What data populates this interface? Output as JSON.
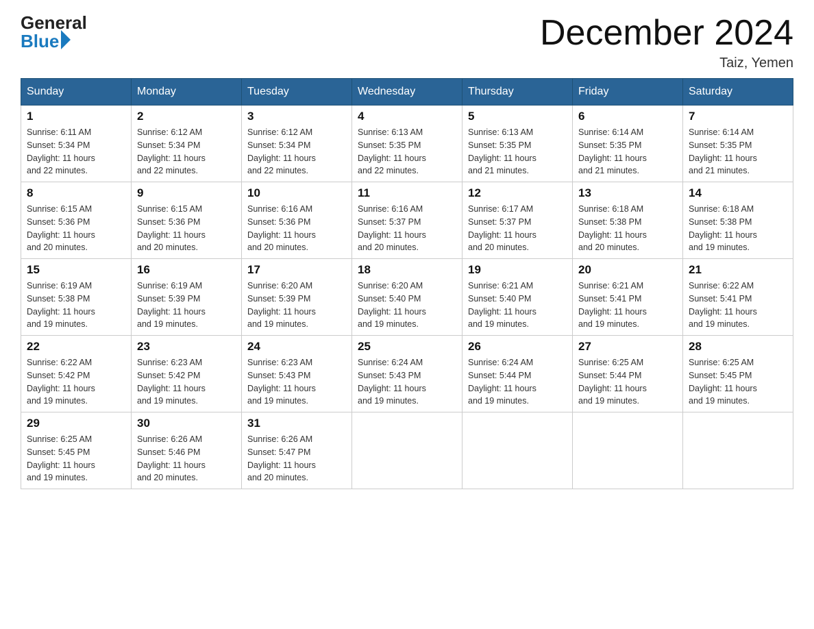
{
  "header": {
    "logo_general": "General",
    "logo_blue": "Blue",
    "month_title": "December 2024",
    "location": "Taiz, Yemen"
  },
  "weekdays": [
    "Sunday",
    "Monday",
    "Tuesday",
    "Wednesday",
    "Thursday",
    "Friday",
    "Saturday"
  ],
  "weeks": [
    [
      {
        "day": "1",
        "sunrise": "6:11 AM",
        "sunset": "5:34 PM",
        "daylight": "11 hours and 22 minutes."
      },
      {
        "day": "2",
        "sunrise": "6:12 AM",
        "sunset": "5:34 PM",
        "daylight": "11 hours and 22 minutes."
      },
      {
        "day": "3",
        "sunrise": "6:12 AM",
        "sunset": "5:34 PM",
        "daylight": "11 hours and 22 minutes."
      },
      {
        "day": "4",
        "sunrise": "6:13 AM",
        "sunset": "5:35 PM",
        "daylight": "11 hours and 22 minutes."
      },
      {
        "day": "5",
        "sunrise": "6:13 AM",
        "sunset": "5:35 PM",
        "daylight": "11 hours and 21 minutes."
      },
      {
        "day": "6",
        "sunrise": "6:14 AM",
        "sunset": "5:35 PM",
        "daylight": "11 hours and 21 minutes."
      },
      {
        "day": "7",
        "sunrise": "6:14 AM",
        "sunset": "5:35 PM",
        "daylight": "11 hours and 21 minutes."
      }
    ],
    [
      {
        "day": "8",
        "sunrise": "6:15 AM",
        "sunset": "5:36 PM",
        "daylight": "11 hours and 20 minutes."
      },
      {
        "day": "9",
        "sunrise": "6:15 AM",
        "sunset": "5:36 PM",
        "daylight": "11 hours and 20 minutes."
      },
      {
        "day": "10",
        "sunrise": "6:16 AM",
        "sunset": "5:36 PM",
        "daylight": "11 hours and 20 minutes."
      },
      {
        "day": "11",
        "sunrise": "6:16 AM",
        "sunset": "5:37 PM",
        "daylight": "11 hours and 20 minutes."
      },
      {
        "day": "12",
        "sunrise": "6:17 AM",
        "sunset": "5:37 PM",
        "daylight": "11 hours and 20 minutes."
      },
      {
        "day": "13",
        "sunrise": "6:18 AM",
        "sunset": "5:38 PM",
        "daylight": "11 hours and 20 minutes."
      },
      {
        "day": "14",
        "sunrise": "6:18 AM",
        "sunset": "5:38 PM",
        "daylight": "11 hours and 19 minutes."
      }
    ],
    [
      {
        "day": "15",
        "sunrise": "6:19 AM",
        "sunset": "5:38 PM",
        "daylight": "11 hours and 19 minutes."
      },
      {
        "day": "16",
        "sunrise": "6:19 AM",
        "sunset": "5:39 PM",
        "daylight": "11 hours and 19 minutes."
      },
      {
        "day": "17",
        "sunrise": "6:20 AM",
        "sunset": "5:39 PM",
        "daylight": "11 hours and 19 minutes."
      },
      {
        "day": "18",
        "sunrise": "6:20 AM",
        "sunset": "5:40 PM",
        "daylight": "11 hours and 19 minutes."
      },
      {
        "day": "19",
        "sunrise": "6:21 AM",
        "sunset": "5:40 PM",
        "daylight": "11 hours and 19 minutes."
      },
      {
        "day": "20",
        "sunrise": "6:21 AM",
        "sunset": "5:41 PM",
        "daylight": "11 hours and 19 minutes."
      },
      {
        "day": "21",
        "sunrise": "6:22 AM",
        "sunset": "5:41 PM",
        "daylight": "11 hours and 19 minutes."
      }
    ],
    [
      {
        "day": "22",
        "sunrise": "6:22 AM",
        "sunset": "5:42 PM",
        "daylight": "11 hours and 19 minutes."
      },
      {
        "day": "23",
        "sunrise": "6:23 AM",
        "sunset": "5:42 PM",
        "daylight": "11 hours and 19 minutes."
      },
      {
        "day": "24",
        "sunrise": "6:23 AM",
        "sunset": "5:43 PM",
        "daylight": "11 hours and 19 minutes."
      },
      {
        "day": "25",
        "sunrise": "6:24 AM",
        "sunset": "5:43 PM",
        "daylight": "11 hours and 19 minutes."
      },
      {
        "day": "26",
        "sunrise": "6:24 AM",
        "sunset": "5:44 PM",
        "daylight": "11 hours and 19 minutes."
      },
      {
        "day": "27",
        "sunrise": "6:25 AM",
        "sunset": "5:44 PM",
        "daylight": "11 hours and 19 minutes."
      },
      {
        "day": "28",
        "sunrise": "6:25 AM",
        "sunset": "5:45 PM",
        "daylight": "11 hours and 19 minutes."
      }
    ],
    [
      {
        "day": "29",
        "sunrise": "6:25 AM",
        "sunset": "5:45 PM",
        "daylight": "11 hours and 19 minutes."
      },
      {
        "day": "30",
        "sunrise": "6:26 AM",
        "sunset": "5:46 PM",
        "daylight": "11 hours and 20 minutes."
      },
      {
        "day": "31",
        "sunrise": "6:26 AM",
        "sunset": "5:47 PM",
        "daylight": "11 hours and 20 minutes."
      },
      null,
      null,
      null,
      null
    ]
  ],
  "labels": {
    "sunrise": "Sunrise:",
    "sunset": "Sunset:",
    "daylight": "Daylight:"
  }
}
